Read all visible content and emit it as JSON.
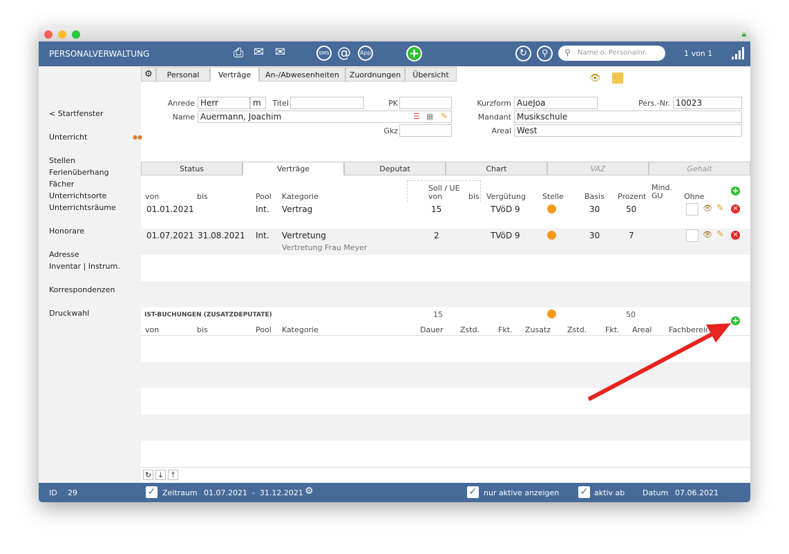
{
  "app": {
    "title": "PERSONALVERWALTUNG",
    "search_placeholder": "Name o. Personalnr.",
    "record_nav": "1 von 1"
  },
  "toolbar_icons": [
    "printer-icon",
    "mail-icon",
    "mail-stack-icon",
    "sms-icon",
    "at-icon",
    "app-icon",
    "add-icon",
    "refresh-icon",
    "search-icon"
  ],
  "sidebar": {
    "items": [
      "< Startfenster",
      "Unterricht",
      "Stellen",
      "Ferienüberhang",
      "Fächer",
      "Unterrichtsorte",
      "Unterrichtsräume",
      "Honorare",
      "Adresse",
      "Inventar | Instrum.",
      "Korrespondenzen",
      "Druckwahl"
    ]
  },
  "tabs": [
    "Personal",
    "Verträge",
    "An-/Abwesenheiten",
    "Zuordnungen",
    "Übersicht"
  ],
  "form": {
    "anrede_label": "Anrede",
    "anrede": "Herr",
    "gender": "m",
    "titel_label": "Titel",
    "titel": "",
    "pk_label": "PK",
    "pk": "",
    "name_label": "Name",
    "name": "Auermann, Joachim",
    "gkz_label": "Gkz",
    "gkz": "",
    "kurzform_label": "Kurzform",
    "kurzform": "AueJoa",
    "persnr_label": "Pers.-Nr.",
    "persnr": "10023",
    "mandant_label": "Mandant",
    "mandant": "Musikschule",
    "areal_label": "Areal",
    "areal": "West"
  },
  "subtabs": [
    "Status",
    "Verträge",
    "Deputat",
    "Chart",
    "VAZ",
    "Gehalt"
  ],
  "contracts": {
    "headers": {
      "von": "von",
      "bis": "bis",
      "pool": "Pool",
      "kategorie": "Kategorie",
      "soll": "Soll / UE",
      "soll_von": "von",
      "soll_bis": "bis",
      "verguetung": "Vergütung",
      "stelle": "Stelle",
      "basis": "Basis",
      "prozent": "Prozent",
      "mind_gu": "Mind. GU",
      "ohne": "Ohne"
    },
    "rows": [
      {
        "von": "01.01.2021",
        "bis": "",
        "pool": "Int.",
        "kategorie": "Vertrag",
        "note": "",
        "soll": "15",
        "verguetung": "TVöD 9",
        "basis": "30",
        "prozent": "50"
      },
      {
        "von": "01.07.2021",
        "bis": "31.08.2021",
        "pool": "Int.",
        "kategorie": "Vertretung",
        "note": "Vertretung Frau Meyer",
        "soll": "2",
        "verguetung": "TVöD 9",
        "basis": "30",
        "prozent": "7"
      }
    ],
    "totals": {
      "soll": "15",
      "prozent": "50"
    }
  },
  "ist": {
    "title": "IST-BUCHUNGEN (ZUSATZDEPUTATE)",
    "headers": [
      "von",
      "bis",
      "Pool",
      "Kategorie",
      "Dauer",
      "Zstd.",
      "Fkt.",
      "Zusatz",
      "Zstd.",
      "Fkt.",
      "Areal",
      "Fachbereich"
    ]
  },
  "footer": {
    "id_label": "ID",
    "id": "29",
    "zeitraum_label": "Zeitraum",
    "zeitraum": "01.07.2021  -  31.12.2021",
    "nur_aktive": "nur aktive anzeigen",
    "aktiv_ab": "aktiv ab",
    "datum_label": "Datum",
    "datum": "07.06.2021"
  },
  "colors": {
    "header": "#466a99",
    "arrow": "#e8231e",
    "add": "#2fbf31",
    "delete": "#e5262b",
    "pie": "#f39a1e"
  }
}
